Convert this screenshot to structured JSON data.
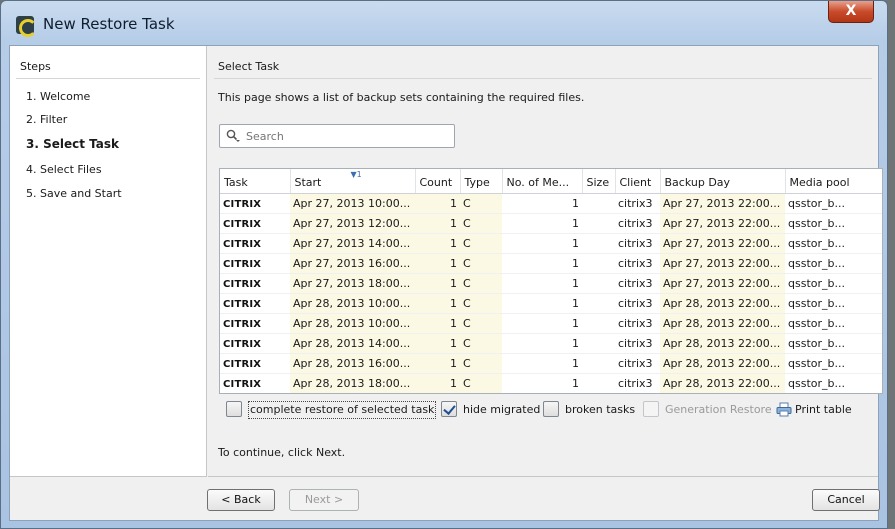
{
  "window": {
    "title": "New Restore Task",
    "close_glyph": "X"
  },
  "steps": {
    "title": "Steps",
    "items": [
      {
        "label": "1. Welcome"
      },
      {
        "label": "2. Filter"
      },
      {
        "label": "3. Select Task"
      },
      {
        "label": "4. Select Files"
      },
      {
        "label": "5. Save and Start"
      }
    ],
    "active_index": 2
  },
  "main": {
    "title": "Select Task",
    "description": "This page shows a list of backup sets containing the required files.",
    "search_placeholder": "Search",
    "continue_text": "To continue, click Next."
  },
  "table": {
    "sort_indicator": "1",
    "columns": [
      "Task",
      "Start",
      "Count",
      "Type",
      "No. of Me...",
      "Size",
      "Client",
      "Backup Day",
      "Media pool"
    ],
    "rows": [
      {
        "task": "CITRIX",
        "start": "Apr 27, 2013 10:00...",
        "count": "1",
        "type": "C",
        "media": "1",
        "size": "",
        "client": "citrix3",
        "backup_day": "Apr 27, 2013 22:00...",
        "pool": "qsstor_b..."
      },
      {
        "task": "CITRIX",
        "start": "Apr 27, 2013 12:00...",
        "count": "1",
        "type": "C",
        "media": "1",
        "size": "",
        "client": "citrix3",
        "backup_day": "Apr 27, 2013 22:00...",
        "pool": "qsstor_b..."
      },
      {
        "task": "CITRIX",
        "start": "Apr 27, 2013 14:00...",
        "count": "1",
        "type": "C",
        "media": "1",
        "size": "",
        "client": "citrix3",
        "backup_day": "Apr 27, 2013 22:00...",
        "pool": "qsstor_b..."
      },
      {
        "task": "CITRIX",
        "start": "Apr 27, 2013 16:00...",
        "count": "1",
        "type": "C",
        "media": "1",
        "size": "",
        "client": "citrix3",
        "backup_day": "Apr 27, 2013 22:00...",
        "pool": "qsstor_b..."
      },
      {
        "task": "CITRIX",
        "start": "Apr 27, 2013 18:00...",
        "count": "1",
        "type": "C",
        "media": "1",
        "size": "",
        "client": "citrix3",
        "backup_day": "Apr 27, 2013 22:00...",
        "pool": "qsstor_b..."
      },
      {
        "task": "CITRIX",
        "start": "Apr 28, 2013 10:00...",
        "count": "1",
        "type": "C",
        "media": "1",
        "size": "",
        "client": "citrix3",
        "backup_day": "Apr 28, 2013 22:00...",
        "pool": "qsstor_b..."
      },
      {
        "task": "CITRIX",
        "start": "Apr 28, 2013 10:00...",
        "count": "1",
        "type": "C",
        "media": "1",
        "size": "",
        "client": "citrix3",
        "backup_day": "Apr 28, 2013 22:00...",
        "pool": "qsstor_b..."
      },
      {
        "task": "CITRIX",
        "start": "Apr 28, 2013 14:00...",
        "count": "1",
        "type": "C",
        "media": "1",
        "size": "",
        "client": "citrix3",
        "backup_day": "Apr 28, 2013 22:00...",
        "pool": "qsstor_b..."
      },
      {
        "task": "CITRIX",
        "start": "Apr 28, 2013 16:00...",
        "count": "1",
        "type": "C",
        "media": "1",
        "size": "",
        "client": "citrix3",
        "backup_day": "Apr 28, 2013 22:00...",
        "pool": "qsstor_b..."
      },
      {
        "task": "CITRIX",
        "start": "Apr 28, 2013 18:00...",
        "count": "1",
        "type": "C",
        "media": "1",
        "size": "",
        "client": "citrix3",
        "backup_day": "Apr 28, 2013 22:00...",
        "pool": "qsstor_b..."
      }
    ]
  },
  "options": {
    "complete_restore": {
      "label": "complete restore of selected task",
      "checked": false
    },
    "hide_migrated": {
      "label": "hide migrated",
      "checked": true
    },
    "broken_tasks": {
      "label": "broken tasks",
      "checked": false
    },
    "generation_restore": {
      "label": "Generation Restore",
      "checked": false,
      "disabled": true
    },
    "print_table": {
      "label": "Print table"
    }
  },
  "buttons": {
    "back": "< Back",
    "next": "Next >",
    "cancel": "Cancel"
  },
  "colors": {
    "title_bar": "#b6cde8",
    "close": "#c94b2b",
    "row_highlight": "#fbf8e4"
  }
}
